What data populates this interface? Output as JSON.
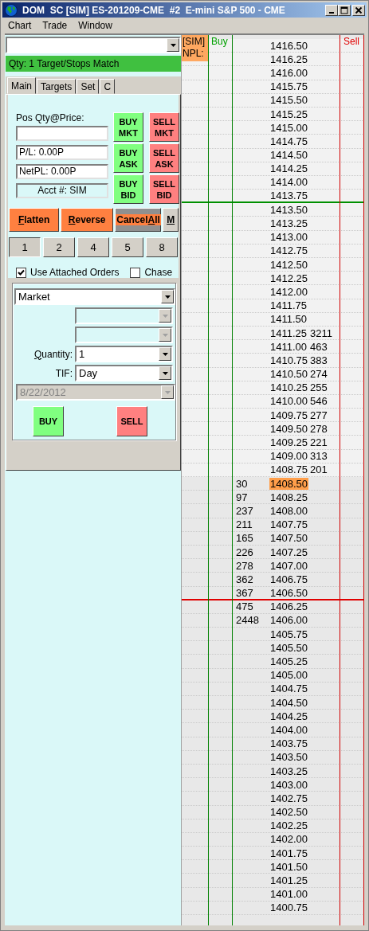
{
  "window": {
    "title": "DOM  SC [SIM] ES-201209-CME  #2  E-mini S&P 500 - CME"
  },
  "menu": [
    "Chart",
    "Trade",
    "Window"
  ],
  "symbol_select": {
    "disabled": false
  },
  "status_bar": {
    "text": "Qty: 1 Target/Stops Match"
  },
  "tabs": [
    {
      "label": "Main",
      "selected": true
    },
    {
      "label": "Targets",
      "selected": false
    },
    {
      "label": "Set",
      "selected": false
    },
    {
      "label": "C",
      "selected": false
    }
  ],
  "position": {
    "label": "Pos Qty@Price:",
    "pl": "P/L: 0.00P",
    "net_pl": "NetPL: 0.00P",
    "account": "Acct #: SIM"
  },
  "order_buttons": [
    {
      "label": "BUY MKT",
      "kind": "buy"
    },
    {
      "label": "SELL MKT",
      "kind": "sell"
    },
    {
      "label": "BUY ASK",
      "kind": "buy"
    },
    {
      "label": "SELL ASK",
      "kind": "sell"
    },
    {
      "label": "BUY BID",
      "kind": "buy"
    },
    {
      "label": "SELL BID",
      "kind": "sell"
    }
  ],
  "action_buttons": [
    {
      "key": "F",
      "post": "latten",
      "kind": "plain"
    },
    {
      "key": "R",
      "post": "everse",
      "kind": "plain"
    },
    {
      "pre": "Cancel",
      "key": "A",
      "post": "ll",
      "kind": "framed"
    },
    {
      "key": "M",
      "kind": "grey"
    }
  ],
  "quantity_buttons": [
    {
      "label": "1",
      "selected": true
    },
    {
      "label": "2",
      "selected": false
    },
    {
      "label": "4",
      "selected": false
    },
    {
      "label": "5",
      "selected": false
    },
    {
      "label": "8",
      "selected": false
    }
  ],
  "options": [
    {
      "label": "Use Attached Orders",
      "checked": true
    },
    {
      "label": "Chase",
      "checked": false
    }
  ],
  "order_form": {
    "order_type": "Market",
    "price_1": {
      "disabled": true
    },
    "price_2": {
      "disabled": true
    },
    "quantity": {
      "label_key": "Q",
      "label_rest": "uantity:",
      "value": "1"
    },
    "tif": {
      "label": "TIF:",
      "value": "Day"
    },
    "date": {
      "value": "8/22/2012",
      "disabled": true
    },
    "buy": "BUY",
    "sell": "SELL"
  },
  "ladder": {
    "account_badge": [
      "[SIM]",
      "NPL:"
    ],
    "buy_header": "Buy",
    "sell_header": "Sell",
    "rows": [
      {
        "price": "1416.50",
        "kind": "ask",
        "last_trade": false
      },
      {
        "price": "1416.25",
        "kind": "ask",
        "last_trade": false
      },
      {
        "price": "1416.00",
        "kind": "ask",
        "last_trade": false
      },
      {
        "price": "1415.75",
        "kind": "ask",
        "last_trade": false
      },
      {
        "price": "1415.50",
        "kind": "ask",
        "last_trade": false
      },
      {
        "price": "1415.25",
        "kind": "ask",
        "last_trade": false
      },
      {
        "price": "1415.00",
        "kind": "ask",
        "last_trade": false
      },
      {
        "price": "1414.75",
        "kind": "ask",
        "last_trade": false
      },
      {
        "price": "1414.50",
        "kind": "ask",
        "last_trade": false
      },
      {
        "price": "1414.25",
        "kind": "ask",
        "last_trade": false
      },
      {
        "price": "1414.00",
        "kind": "ask",
        "last_trade": false
      },
      {
        "price": "1413.75",
        "kind": "ask",
        "last_trade": false,
        "color": "#009000"
      },
      {
        "price": "1413.50",
        "kind": "ask",
        "last_trade": false
      },
      {
        "price": "1413.25",
        "kind": "ask",
        "last_trade": false
      },
      {
        "price": "1413.00",
        "kind": "ask",
        "last_trade": false
      },
      {
        "price": "1412.75",
        "kind": "ask",
        "last_trade": false
      },
      {
        "price": "1412.50",
        "kind": "ask",
        "last_trade": false
      },
      {
        "price": "1412.25",
        "kind": "ask",
        "last_trade": false
      },
      {
        "price": "1412.00",
        "kind": "ask",
        "last_trade": false
      },
      {
        "price": "1411.75",
        "kind": "ask",
        "last_trade": false
      },
      {
        "price": "1411.50",
        "kind": "ask",
        "last_trade": false
      },
      {
        "price": "1411.25",
        "kind": "ask",
        "ask": "3211",
        "last_trade": false
      },
      {
        "price": "1411.00",
        "kind": "ask",
        "ask": "463",
        "last_trade": false
      },
      {
        "price": "1410.75",
        "kind": "ask",
        "ask": "383",
        "last_trade": false
      },
      {
        "price": "1410.50",
        "kind": "ask",
        "ask": "274",
        "last_trade": false
      },
      {
        "price": "1410.25",
        "kind": "ask",
        "ask": "255",
        "last_trade": false
      },
      {
        "price": "1410.00",
        "kind": "ask",
        "ask": "546",
        "last_trade": false
      },
      {
        "price": "1409.75",
        "kind": "ask",
        "ask": "277",
        "last_trade": false
      },
      {
        "price": "1409.50",
        "kind": "ask",
        "ask": "278",
        "last_trade": false
      },
      {
        "price": "1409.25",
        "kind": "ask",
        "ask": "221",
        "last_trade": false
      },
      {
        "price": "1409.00",
        "kind": "ask",
        "ask": "313",
        "last_trade": false
      },
      {
        "price": "1408.75",
        "kind": "ask",
        "ask": "201",
        "last_trade": false
      },
      {
        "price": "1408.50",
        "kind": "bid",
        "bid": "30",
        "last_trade": true
      },
      {
        "price": "1408.25",
        "kind": "bid",
        "bid": "97",
        "last_trade": false
      },
      {
        "price": "1408.00",
        "kind": "bid",
        "bid": "237",
        "last_trade": false
      },
      {
        "price": "1407.75",
        "kind": "bid",
        "bid": "211",
        "last_trade": false
      },
      {
        "price": "1407.50",
        "kind": "bid",
        "bid": "165",
        "last_trade": false
      },
      {
        "price": "1407.25",
        "kind": "bid",
        "bid": "226",
        "last_trade": false
      },
      {
        "price": "1407.00",
        "kind": "bid",
        "bid": "278",
        "last_trade": false
      },
      {
        "price": "1406.75",
        "kind": "bid",
        "bid": "362",
        "last_trade": false
      },
      {
        "price": "1406.50",
        "kind": "bid",
        "bid": "367",
        "last_trade": false,
        "color": "#e00000"
      },
      {
        "price": "1406.25",
        "kind": "bid",
        "bid": "475",
        "last_trade": false
      },
      {
        "price": "1406.00",
        "kind": "bid",
        "bid": "2448",
        "last_trade": false
      },
      {
        "price": "1405.75",
        "kind": "bid",
        "last_trade": false
      },
      {
        "price": "1405.50",
        "kind": "bid",
        "last_trade": false
      },
      {
        "price": "1405.25",
        "kind": "bid",
        "last_trade": false
      },
      {
        "price": "1405.00",
        "kind": "bid",
        "last_trade": false
      },
      {
        "price": "1404.75",
        "kind": "bid",
        "last_trade": false
      },
      {
        "price": "1404.50",
        "kind": "bid",
        "last_trade": false
      },
      {
        "price": "1404.25",
        "kind": "bid",
        "last_trade": false
      },
      {
        "price": "1404.00",
        "kind": "bid",
        "last_trade": false
      },
      {
        "price": "1403.75",
        "kind": "bid",
        "last_trade": false
      },
      {
        "price": "1403.50",
        "kind": "bid",
        "last_trade": false
      },
      {
        "price": "1403.25",
        "kind": "bid",
        "last_trade": false
      },
      {
        "price": "1403.00",
        "kind": "bid",
        "last_trade": false
      },
      {
        "price": "1402.75",
        "kind": "bid",
        "last_trade": false
      },
      {
        "price": "1402.50",
        "kind": "bid",
        "last_trade": false
      },
      {
        "price": "1402.25",
        "kind": "bid",
        "last_trade": false
      },
      {
        "price": "1402.00",
        "kind": "bid",
        "last_trade": false
      },
      {
        "price": "1401.75",
        "kind": "bid",
        "last_trade": false
      },
      {
        "price": "1401.50",
        "kind": "bid",
        "last_trade": false
      },
      {
        "price": "1401.25",
        "kind": "bid",
        "last_trade": false
      },
      {
        "price": "1401.00",
        "kind": "bid",
        "last_trade": false
      },
      {
        "price": "1400.75",
        "kind": "bid",
        "last_trade": false
      }
    ]
  }
}
